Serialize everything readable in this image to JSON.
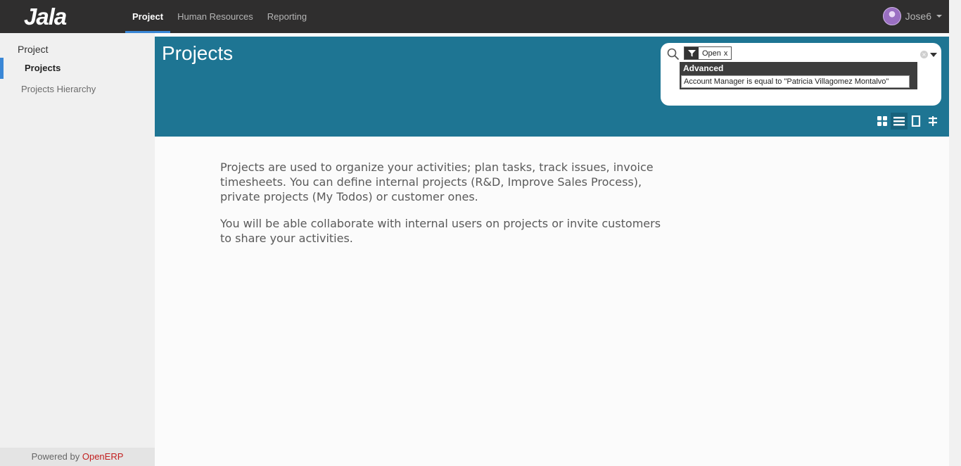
{
  "topbar": {
    "logo": "Jala",
    "menu": [
      {
        "label": "Project",
        "active": true
      },
      {
        "label": "Human Resources",
        "active": false
      },
      {
        "label": "Reporting",
        "active": false
      }
    ],
    "user_name": "Jose6"
  },
  "sidebar": {
    "section": "Project",
    "items": [
      {
        "label": "Projects",
        "active": true
      },
      {
        "label": "Projects Hierarchy",
        "active": false
      }
    ],
    "powered_prefix": "Powered by ",
    "powered_brand": "OpenERP"
  },
  "page": {
    "title": "Projects"
  },
  "search": {
    "facet_label": "Open",
    "facet_remove": "x",
    "advanced_header": "Advanced",
    "advanced_filter": "Account Manager is equal to \"Patricia Villagomez Montalvo\""
  },
  "views": [
    "kanban-view-icon",
    "list-view-icon",
    "form-view-icon",
    "gantt-view-icon"
  ],
  "help": {
    "paragraph1": "Projects are used to organize your activities; plan tasks, track issues, invoice timesheets. You can define internal projects (R&D, Improve Sales Process), private projects (My Todos) or customer ones.",
    "paragraph2": "You will be able collaborate with internal users on projects or invite customers to share your activities."
  },
  "colors": {
    "topbar": "#2f2e2e",
    "accent": "#3a87d6",
    "header_band": "#1e7593",
    "brand_red": "#c21e1e"
  }
}
